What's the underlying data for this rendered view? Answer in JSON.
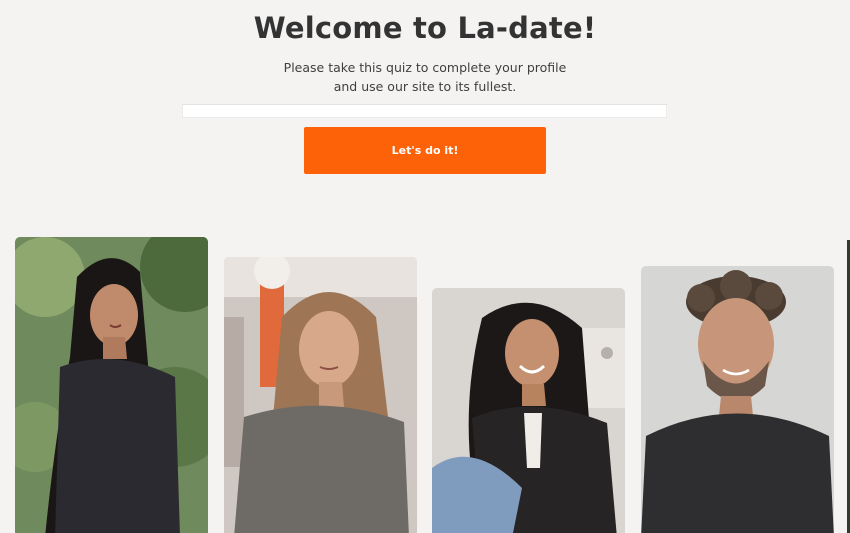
{
  "header": {
    "title": "Welcome to La-date!",
    "subtitle_line1": "Please take this quiz to complete your profile",
    "subtitle_line2": "and use our site to its fullest."
  },
  "cta": {
    "label": "Let's do it!"
  },
  "colors": {
    "accent": "#fe6208",
    "background": "#f4f3f2",
    "title": "#333333"
  },
  "profiles": [
    {
      "kind": "woman-dark-hair-outdoor-photo"
    },
    {
      "kind": "woman-long-light-hair-photo"
    },
    {
      "kind": "woman-smiling-blazer-photo"
    },
    {
      "kind": "man-curly-hair-beard-photo"
    }
  ]
}
